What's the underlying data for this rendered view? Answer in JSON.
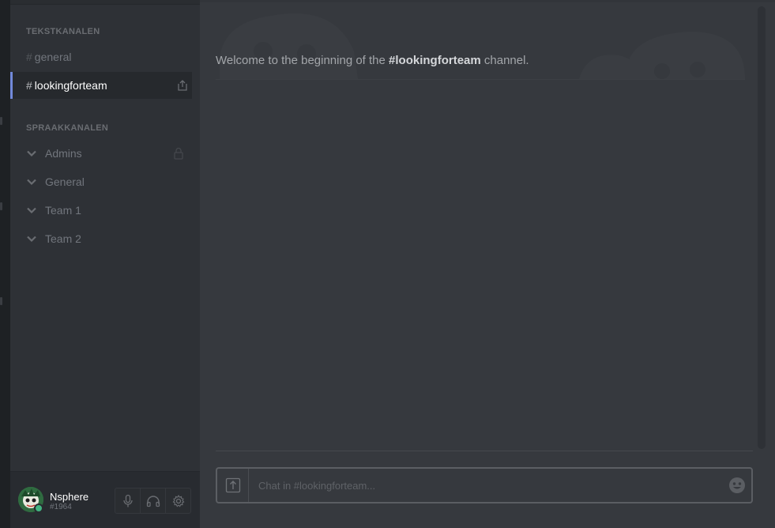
{
  "sidebar": {
    "text_header": "TEKSTKANALEN",
    "text_channels": [
      {
        "hash": "#",
        "name": "general"
      },
      {
        "hash": "#",
        "name": "lookingforteam"
      }
    ],
    "voice_header": "SPRAAKKANALEN",
    "voice_channels": [
      {
        "name": "Admins"
      },
      {
        "name": "General"
      },
      {
        "name": "Team 1"
      },
      {
        "name": "Team 2"
      }
    ]
  },
  "user": {
    "name": "Nsphere",
    "discriminator": "#1964",
    "status_color": "#43b581"
  },
  "controls": [
    "microphone-icon",
    "headphones-icon",
    "gear-icon"
  ],
  "channel": {
    "welcome_prefix": "Welcome to the beginning of the ",
    "welcome_channel": "#lookingforteam",
    "welcome_suffix": " channel."
  },
  "chat": {
    "placeholder": "Chat in #lookingforteam..."
  },
  "colors": {
    "accent": "#7289da",
    "sidebar_bg": "#2e3136",
    "main_bg": "#36393e",
    "online": "#43b581"
  }
}
